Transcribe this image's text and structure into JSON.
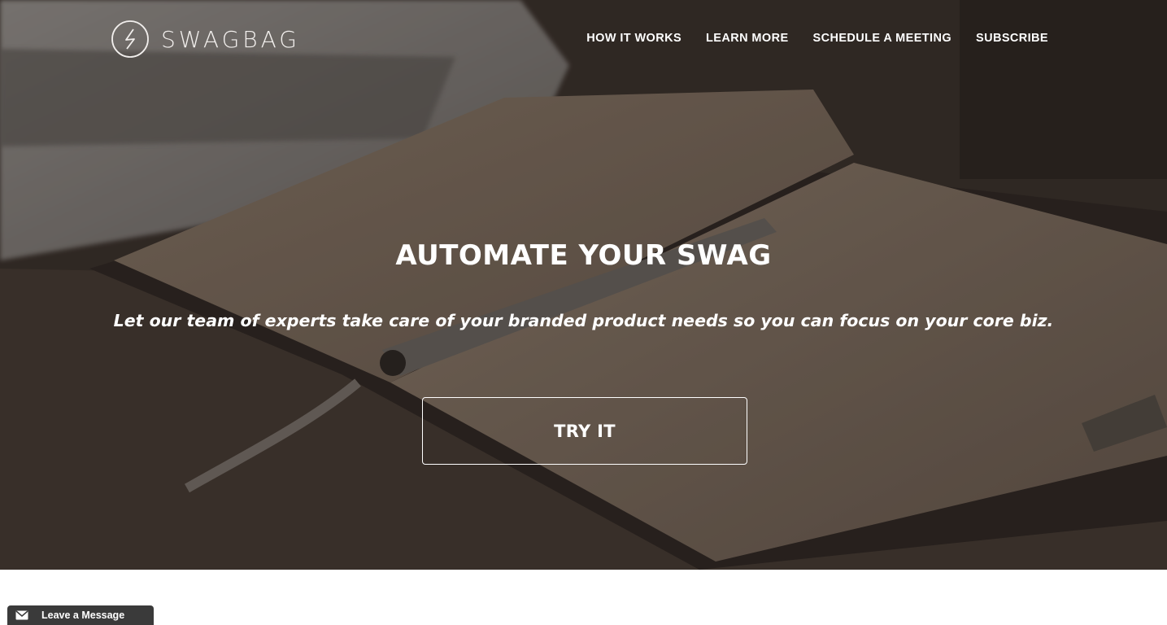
{
  "brand": {
    "name": "SWAGBAG",
    "icon": "lightning-bolt-circle-icon"
  },
  "nav": {
    "items": [
      {
        "label": "HOW IT WORKS"
      },
      {
        "label": "LEARN MORE"
      },
      {
        "label": "SCHEDULE A MEETING"
      },
      {
        "label": "SUBSCRIBE"
      }
    ]
  },
  "hero": {
    "title": "AUTOMATE YOUR SWAG",
    "subtitle": "Let our team of experts take care of your branded product needs so you can focus on your core biz.",
    "cta_label": "TRY IT"
  },
  "chat": {
    "label": "Leave a Message",
    "icon": "mail-icon"
  },
  "colors": {
    "text": "#ffffff",
    "hero_dark": "#3b332e",
    "chat_tab": "#3a3a3a"
  }
}
